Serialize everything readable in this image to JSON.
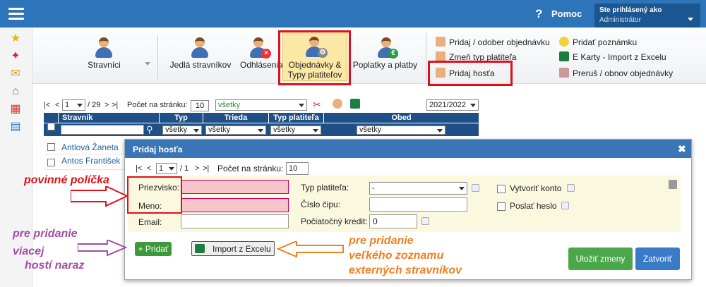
{
  "header": {
    "help_q": "?",
    "help_label": "Pomoc",
    "user_prefix": "Ste prihlásený ako",
    "user_name": "Administrátor"
  },
  "sidebar": {
    "icons": [
      "star-icon",
      "magic-wand-icon",
      "envelope-icon",
      "home-icon",
      "calendar-icon",
      "book-icon"
    ]
  },
  "ribbon": {
    "stravnici": "Stravníci",
    "jedla": "Jedlá stravníkov",
    "odhlasenia": "Odhlásenia",
    "objednavky_1": "Objednávky &",
    "objednavky_2": "Typy platiteľov",
    "poplatky": "Poplatky a platby",
    "links": [
      "Pridaj / odober objednávku",
      "Zmeň typ platiteľa",
      "Pridaj hosťa",
      "Pridať poznámku",
      "E Karty - Import z Excelu",
      "Preruš / obnov objednávky"
    ]
  },
  "pager": {
    "first": "|<",
    "prev": "<",
    "page": "1",
    "total": "/ 29",
    "next": ">",
    "last": ">|",
    "per_page_label": "Počet na stránku:",
    "per_page": "10",
    "filter": "všetky",
    "year": "2021/2022"
  },
  "table": {
    "headers": [
      "Stravník",
      "Typ",
      "Trieda",
      "Typ platiteľa",
      "Obed"
    ],
    "filters": [
      "všetky",
      "všetky",
      "všetky",
      "všetky"
    ],
    "rows": [
      "Antlová Žaneta",
      "Antos František"
    ]
  },
  "modal": {
    "title": "Pridaj hosťa",
    "close": "✖",
    "pager": {
      "first": "|<",
      "prev": "<",
      "page": "1",
      "total": "/ 1",
      "next": ">",
      "last": ">|",
      "per_page_label": "Počet na stránku:",
      "per_page": "10"
    },
    "labels": {
      "priezvisko": "Priezvisko:",
      "meno": "Meno:",
      "email": "Email:",
      "typ_platitela": "Typ platiteľa:",
      "cislo_cipu": "Číslo čipu:",
      "kredit": "Počiatočný kredit:",
      "vytvorit_konto": "Vytvoriť konto",
      "poslat_heslo": "Poslať heslo"
    },
    "values": {
      "typ_platitela": "-",
      "kredit": "0"
    },
    "buttons": {
      "pridat": "+ Pridať",
      "import": "Import z Excelu",
      "save": "Uložiť zmeny",
      "close": "Zatvoriť"
    }
  },
  "annotations": {
    "required": "povinné políčka",
    "multi_1": "pre pridanie",
    "multi_2": "viacej",
    "multi_3": "hostí naraz",
    "import_1": "pre pridanie",
    "import_2": "veľkého zoznamu",
    "import_3": "externých stravníkov"
  },
  "colors": {
    "header": "#2d74b9",
    "table_head": "#1e4f86",
    "highlight": "#e0101a",
    "anno_red": "#e0101a",
    "anno_purple": "#a64ca6",
    "anno_orange": "#f08020",
    "save_green": "#4aa84a",
    "close_blue": "#3a7bc8"
  }
}
